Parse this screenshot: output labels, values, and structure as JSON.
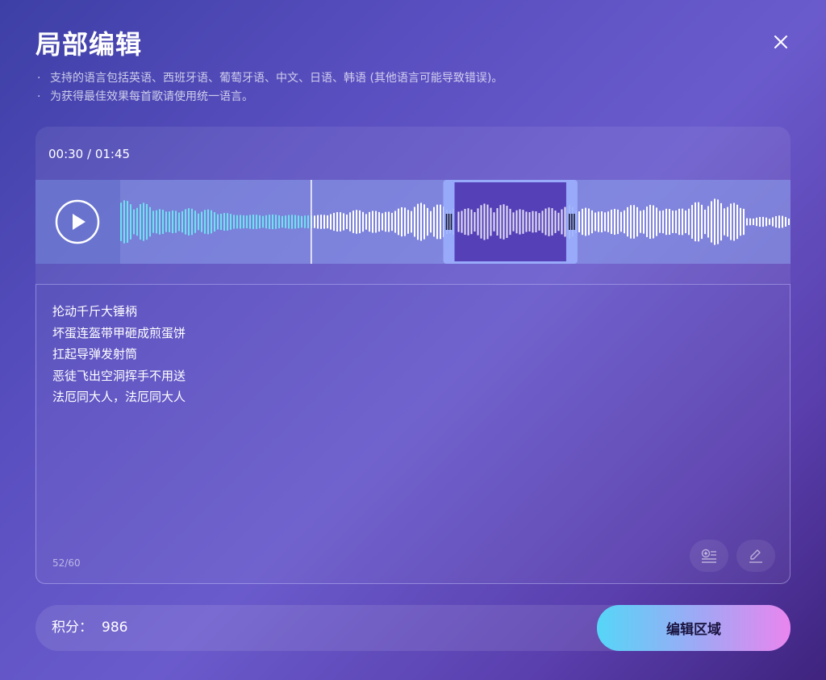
{
  "dialog": {
    "title": "局部编辑",
    "close_icon": "close-icon",
    "notes": [
      "支持的语言包括英语、西班牙语、葡萄牙语、中文、日语、韩语 (其他语言可能导致错误)。",
      "为获得最佳效果每首歌请使用统一语言。"
    ]
  },
  "player": {
    "current_time": "00:30",
    "separator": " / ",
    "total_time": "01:45",
    "progress_fraction": 0.2857,
    "selection_start_fraction": 0.5,
    "selection_end_fraction": 0.667,
    "play_icon": "play-icon"
  },
  "lyrics": {
    "lines": [
      "抡动千斤大锤柄",
      "坏蛋连盔带甲砸成煎蛋饼",
      "扛起导弹发射筒",
      "恶徒飞出空洞挥手不用送",
      "法厄同大人，法厄同大人"
    ],
    "char_count": "52/60",
    "tools": [
      "add-list-icon",
      "edit-pencil-icon"
    ]
  },
  "footer": {
    "points_label": "积分：",
    "points_value": "986",
    "edit_button_label": "编辑区域"
  },
  "colors": {
    "played_wave": "#6fe0f0",
    "unplayed_wave": "#ffffff",
    "selection_fill": "#5540b8",
    "selection_frame": "#9aaefc"
  }
}
